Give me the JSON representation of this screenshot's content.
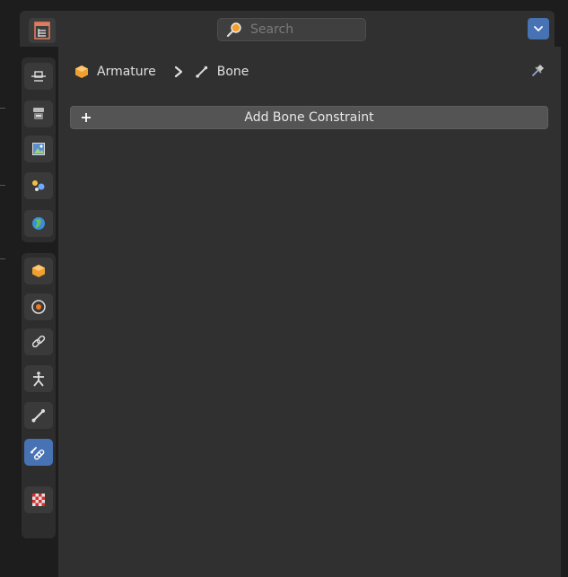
{
  "header": {
    "search": {
      "placeholder": "Search",
      "value": ""
    }
  },
  "tabs": [
    {
      "name": "tool",
      "icon": "tool-icon"
    },
    {
      "name": "render",
      "icon": "render-icon"
    },
    {
      "name": "output",
      "icon": "output-icon"
    },
    {
      "name": "view-layer",
      "icon": "view-layer-icon"
    },
    {
      "name": "scene",
      "icon": "scene-icon"
    },
    {
      "name": "world",
      "icon": "world-icon"
    },
    {
      "name": "object",
      "icon": "object-icon"
    },
    {
      "name": "physics",
      "icon": "physics-icon"
    },
    {
      "name": "object-constraints",
      "icon": "constraint-link-icon"
    },
    {
      "name": "object-data",
      "icon": "armature-icon"
    },
    {
      "name": "bone",
      "icon": "bone-icon"
    },
    {
      "name": "bone-constraints",
      "icon": "bone-constraint-icon",
      "active": true
    },
    {
      "name": "texture",
      "icon": "texture-checker-icon"
    }
  ],
  "breadcrumb": {
    "object_label": "Armature",
    "bone_label": "Bone"
  },
  "main": {
    "add_constraint_label": "Add Bone Constraint"
  },
  "colors": {
    "accent": "#4772b3",
    "panel_bg": "#303030",
    "dark_bg": "#1d1d1d",
    "button_bg": "#545454",
    "object_orange": "#f0a030"
  }
}
